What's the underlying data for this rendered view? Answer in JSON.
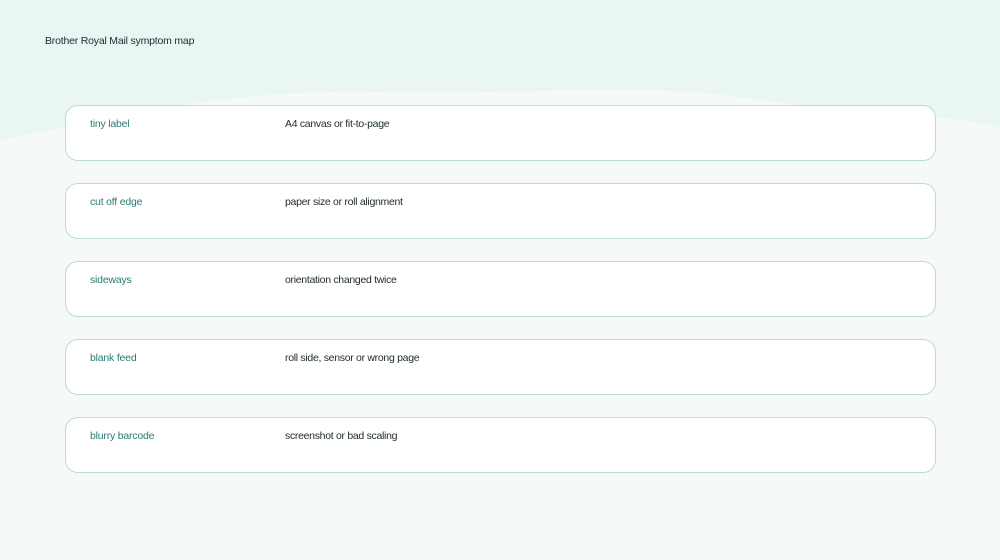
{
  "title": "Brother Royal Mail symptom map",
  "rows": [
    {
      "symptom": "tiny label",
      "cause": "A4 canvas or fit-to-page"
    },
    {
      "symptom": "cut off edge",
      "cause": "paper size or roll alignment"
    },
    {
      "symptom": "sideways",
      "cause": "orientation changed twice"
    },
    {
      "symptom": "blank feed",
      "cause": "roll side, sensor or wrong page"
    },
    {
      "symptom": "blurry barcode",
      "cause": "screenshot or bad scaling"
    }
  ],
  "colors": {
    "background": "#f5faf9",
    "wave": "#e9f6f3",
    "card_border": "#b9ddd5",
    "symptom_text": "#2c7b72",
    "cause_text": "#1e2b2b"
  }
}
